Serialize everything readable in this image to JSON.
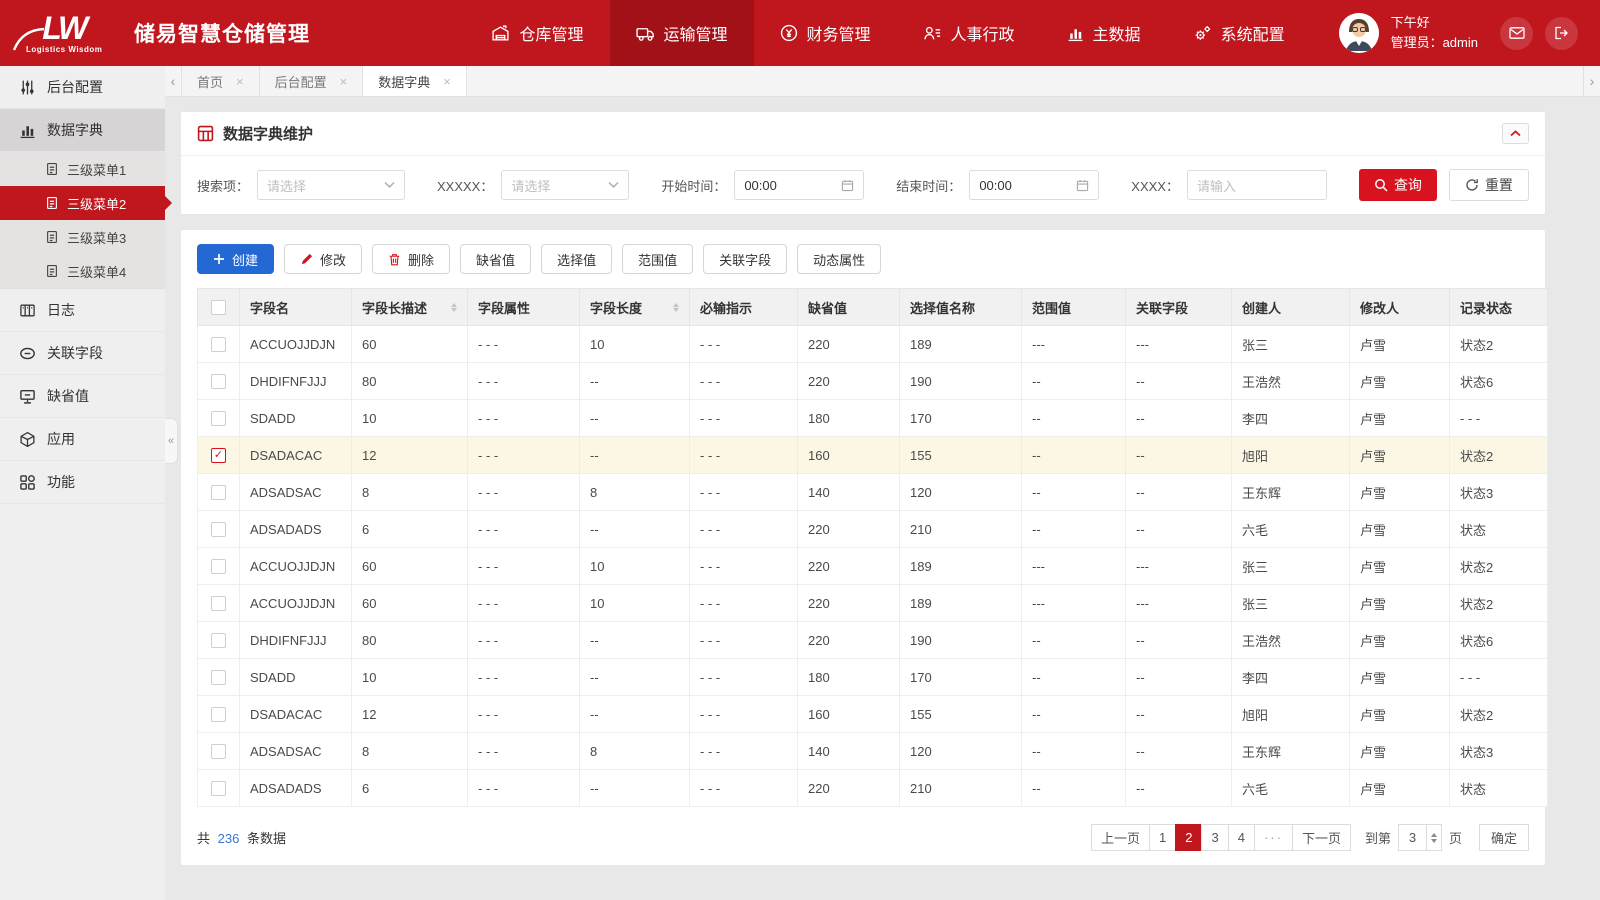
{
  "header": {
    "logo_text": "LW",
    "logo_subtitle": "Logistics Wisdom",
    "app_title": "储易智慧仓储管理",
    "nav": [
      {
        "label": "仓库管理",
        "icon": "warehouse-icon",
        "active": false
      },
      {
        "label": "运输管理",
        "icon": "truck-icon",
        "active": true
      },
      {
        "label": "财务管理",
        "icon": "finance-icon",
        "active": false
      },
      {
        "label": "人事行政",
        "icon": "people-icon",
        "active": false
      },
      {
        "label": "主数据",
        "icon": "bar-chart-icon",
        "active": false
      },
      {
        "label": "系统配置",
        "icon": "gear-icon",
        "active": false
      }
    ],
    "greeting": "下午好",
    "user_label": "管理员：admin",
    "actions": [
      {
        "icon": "mail-icon"
      },
      {
        "icon": "logout-icon"
      }
    ]
  },
  "sidebar": {
    "collapse_glyph": "«",
    "items": [
      {
        "label": "后台配置",
        "icon": "sliders-icon",
        "type": "parent",
        "state": "normal"
      },
      {
        "label": "数据字典",
        "icon": "bar-chart-icon",
        "type": "parent",
        "state": "selected"
      },
      {
        "label": "三级菜单1",
        "icon": "doc-icon",
        "type": "sub",
        "state": "normal"
      },
      {
        "label": "三级菜单2",
        "icon": "doc-icon",
        "type": "sub",
        "state": "active"
      },
      {
        "label": "三级菜单3",
        "icon": "doc-icon",
        "type": "sub",
        "state": "normal"
      },
      {
        "label": "三级菜单4",
        "icon": "doc-icon",
        "type": "sub",
        "state": "normal"
      },
      {
        "label": "日志",
        "icon": "archive-icon",
        "type": "parent",
        "state": "normal"
      },
      {
        "label": "关联字段",
        "icon": "link-icon",
        "type": "parent",
        "state": "normal"
      },
      {
        "label": "缺省值",
        "icon": "monitor-icon",
        "type": "parent",
        "state": "normal"
      },
      {
        "label": "应用",
        "icon": "cube-icon",
        "type": "parent",
        "state": "normal"
      },
      {
        "label": "功能",
        "icon": "blocks-icon",
        "type": "parent",
        "state": "normal"
      }
    ]
  },
  "tabs": {
    "items": [
      {
        "label": "首页",
        "active": false
      },
      {
        "label": "后台配置",
        "active": false
      },
      {
        "label": "数据字典",
        "active": true
      }
    ]
  },
  "panel": {
    "title": "数据字典维护",
    "filters": {
      "search_label": "搜索项：",
      "search_placeholder": "请选择",
      "xxxxx_label": "XXXXX：",
      "xxxxx_placeholder": "请选择",
      "start_label": "开始时间：",
      "start_value": "00:00",
      "end_label": "结束时间：",
      "end_value": "00:00",
      "xxxx_label": "XXXX：",
      "xxxx_placeholder": "请输入",
      "query_label": "查询",
      "reset_label": "重置"
    }
  },
  "toolbar": {
    "buttons": [
      {
        "label": "创建",
        "icon": "plus-icon",
        "style": "primary"
      },
      {
        "label": "修改",
        "icon": "pencil-icon",
        "style": "default"
      },
      {
        "label": "删除",
        "icon": "trash-icon",
        "style": "default"
      },
      {
        "label": "缺省值",
        "style": "default"
      },
      {
        "label": "选择值",
        "style": "default"
      },
      {
        "label": "范围值",
        "style": "default"
      },
      {
        "label": "关联字段",
        "style": "default"
      },
      {
        "label": "动态属性",
        "style": "default"
      }
    ]
  },
  "table": {
    "columns": [
      {
        "label": "字段名"
      },
      {
        "label": "字段长描述",
        "sortable": true
      },
      {
        "label": "字段属性"
      },
      {
        "label": "字段长度",
        "sortable": true
      },
      {
        "label": "必输指示"
      },
      {
        "label": "缺省值"
      },
      {
        "label": "选择值名称"
      },
      {
        "label": "范围值"
      },
      {
        "label": "关联字段"
      },
      {
        "label": "创建人"
      },
      {
        "label": "修改人"
      },
      {
        "label": "记录状态"
      }
    ],
    "rows": [
      {
        "checked": false,
        "highlight": false,
        "cells": [
          "ACCUOJJDJN",
          "60",
          "- - -",
          "10",
          "- - -",
          "220",
          "189",
          "---",
          "---",
          "张三",
          "卢雪",
          "状态2"
        ]
      },
      {
        "checked": false,
        "highlight": false,
        "cells": [
          "DHDIFNFJJJ",
          "80",
          "- - -",
          "--",
          "- - -",
          "220",
          "190",
          "--",
          "--",
          "王浩然",
          "卢雪",
          "状态6"
        ]
      },
      {
        "checked": false,
        "highlight": false,
        "cells": [
          "SDADD",
          "10",
          "- - -",
          "--",
          "- - -",
          "180",
          "170",
          "--",
          "--",
          "李四",
          "卢雪",
          "- - -"
        ]
      },
      {
        "checked": true,
        "highlight": true,
        "cells": [
          "DSADACAC",
          "12",
          "- - -",
          "--",
          "- - -",
          "160",
          "155",
          "--",
          "--",
          "旭阳",
          "卢雪",
          "状态2"
        ]
      },
      {
        "checked": false,
        "highlight": false,
        "cells": [
          "ADSADSAC",
          "8",
          "- - -",
          "8",
          "- - -",
          "140",
          "120",
          "--",
          "--",
          "王东辉",
          "卢雪",
          "状态3"
        ]
      },
      {
        "checked": false,
        "highlight": false,
        "cells": [
          "ADSADADS",
          "6",
          "- - -",
          "--",
          "- - -",
          "220",
          "210",
          "--",
          "--",
          "六毛",
          "卢雪",
          "状态"
        ]
      },
      {
        "checked": false,
        "highlight": false,
        "cells": [
          "ACCUOJJDJN",
          "60",
          "- - -",
          "10",
          "- - -",
          "220",
          "189",
          "---",
          "---",
          "张三",
          "卢雪",
          "状态2"
        ]
      },
      {
        "checked": false,
        "highlight": false,
        "cells": [
          "ACCUOJJDJN",
          "60",
          "- - -",
          "10",
          "- - -",
          "220",
          "189",
          "---",
          "---",
          "张三",
          "卢雪",
          "状态2"
        ]
      },
      {
        "checked": false,
        "highlight": false,
        "cells": [
          "DHDIFNFJJJ",
          "80",
          "- - -",
          "--",
          "- - -",
          "220",
          "190",
          "--",
          "--",
          "王浩然",
          "卢雪",
          "状态6"
        ]
      },
      {
        "checked": false,
        "highlight": false,
        "cells": [
          "SDADD",
          "10",
          "- - -",
          "--",
          "- - -",
          "180",
          "170",
          "--",
          "--",
          "李四",
          "卢雪",
          "- - -"
        ]
      },
      {
        "checked": false,
        "highlight": false,
        "cells": [
          "DSADACAC",
          "12",
          "- - -",
          "--",
          "- - -",
          "160",
          "155",
          "--",
          "--",
          "旭阳",
          "卢雪",
          "状态2"
        ]
      },
      {
        "checked": false,
        "highlight": false,
        "cells": [
          "ADSADSAC",
          "8",
          "- - -",
          "8",
          "- - -",
          "140",
          "120",
          "--",
          "--",
          "王东辉",
          "卢雪",
          "状态3"
        ]
      },
      {
        "checked": false,
        "highlight": false,
        "cells": [
          "ADSADADS",
          "6",
          "- - -",
          "--",
          "- - -",
          "220",
          "210",
          "--",
          "--",
          "六毛",
          "卢雪",
          "状态"
        ]
      }
    ]
  },
  "footer": {
    "total_prefix": "共",
    "total_count": "236",
    "total_suffix": "条数据",
    "pager": [
      {
        "label": "上一页",
        "type": "btn"
      },
      {
        "label": "1",
        "type": "page",
        "active": false
      },
      {
        "label": "2",
        "type": "page",
        "active": true
      },
      {
        "label": "3",
        "type": "page",
        "active": false
      },
      {
        "label": "4",
        "type": "page",
        "active": false
      },
      {
        "label": "···",
        "type": "ellipsis"
      },
      {
        "label": "下一页",
        "type": "btn"
      }
    ],
    "goto_prefix": "到第",
    "goto_value": "3",
    "goto_suffix": "页",
    "confirm_label": "确定"
  },
  "colors": {
    "header_red": "#C0161E",
    "header_active_red": "#A31118",
    "accent_red": "#D8131F",
    "primary_blue": "#2468D4",
    "link_blue": "#3576D9",
    "row_highlight": "#FBF7E4"
  }
}
